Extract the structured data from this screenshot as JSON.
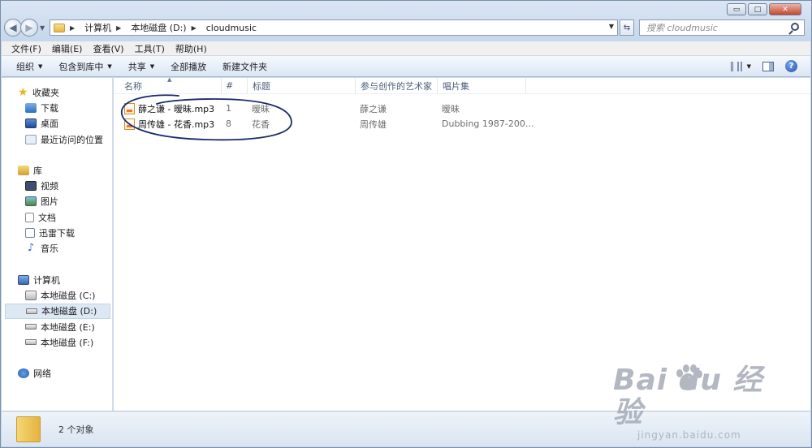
{
  "window": {
    "caption": {
      "minimize": "▭",
      "maximize": "□",
      "close": "✕"
    }
  },
  "address": {
    "crumbs": [
      "计算机",
      "本地磁盘 (D:)",
      "cloudmusic"
    ],
    "search_placeholder": "搜索 cloudmusic"
  },
  "menu": [
    "文件(F)",
    "编辑(E)",
    "查看(V)",
    "工具(T)",
    "帮助(H)"
  ],
  "toolbar": {
    "organize": "组织",
    "include_library": "包含到库中",
    "share": "共享",
    "play_all": "全部播放",
    "new_folder": "新建文件夹"
  },
  "sidebar": {
    "favorites": {
      "label": "收藏夹",
      "items": [
        "下载",
        "桌面",
        "最近访问的位置"
      ]
    },
    "libraries": {
      "label": "库",
      "items": [
        "视频",
        "图片",
        "文档",
        "迅雷下载",
        "音乐"
      ]
    },
    "computer": {
      "label": "计算机",
      "items": [
        "本地磁盘 (C:)",
        "本地磁盘 (D:)",
        "本地磁盘 (E:)",
        "本地磁盘 (F:)"
      ],
      "selected_index": 1
    },
    "network": {
      "label": "网络"
    }
  },
  "columns": [
    "名称",
    "#",
    "标题",
    "参与创作的艺术家",
    "唱片集"
  ],
  "files": [
    {
      "name": "薛之谦 - 暧昧.mp3",
      "number": "1",
      "title": "暧昧",
      "artist": "薛之谦",
      "album": "暧昧"
    },
    {
      "name": "周传雄 - 花香.mp3",
      "number": "8",
      "title": "花香",
      "artist": "周传雄",
      "album": "Dubbing 1987-200..."
    }
  ],
  "status": {
    "count": "2 个对象"
  },
  "watermark": {
    "logo": "Bai du 经验",
    "url": "jingyan.baidu.com"
  },
  "colors": {
    "annotation_ink": "#1b2a6b",
    "selected_bg": "#dde8f5"
  }
}
